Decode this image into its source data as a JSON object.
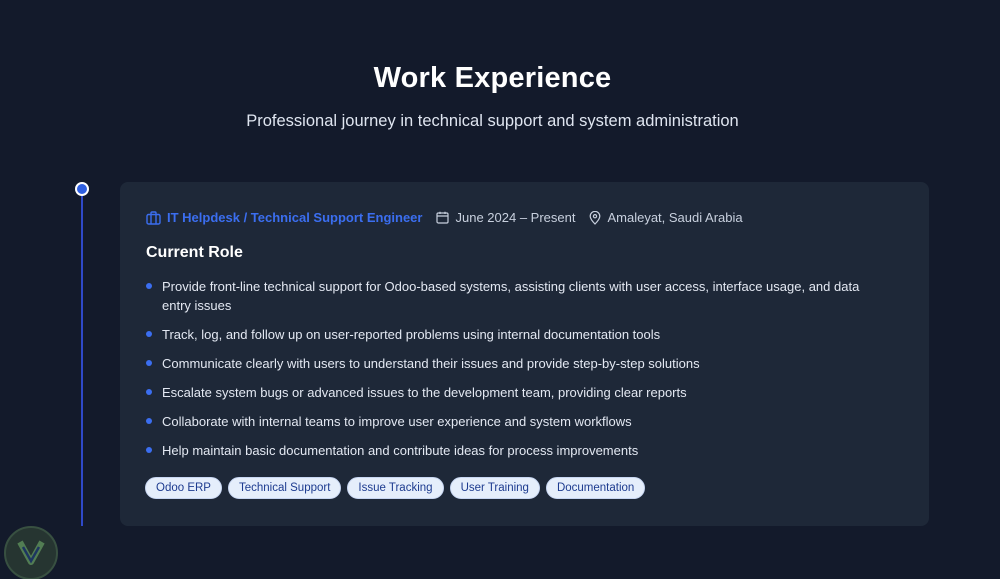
{
  "section": {
    "title": "Work Experience",
    "subtitle": "Professional journey in technical support and system administration"
  },
  "job": {
    "title": "IT Helpdesk / Technical Support Engineer",
    "dates": "June 2024 – Present",
    "location": "Amaleyat, Saudi Arabia",
    "role_heading": "Current Role",
    "duties": [
      "Provide front-line technical support for Odoo-based systems, assisting clients with user access, interface usage, and data entry issues",
      "Track, log, and follow up on user-reported problems using internal documentation tools",
      "Communicate clearly with users to understand their issues and provide step-by-step solutions",
      "Escalate system bugs or advanced issues to the development team, providing clear reports",
      "Collaborate with internal teams to improve user experience and system workflows",
      "Help maintain basic documentation and contribute ideas for process improvements"
    ],
    "tags": [
      "Odoo ERP",
      "Technical Support",
      "Issue Tracking",
      "User Training",
      "Documentation"
    ]
  },
  "icons": {
    "job": "briefcase-icon",
    "dates": "calendar-icon",
    "location": "map-pin-icon"
  },
  "colors": {
    "background": "#131a2b",
    "card": "#1e2838",
    "accent": "#3b6ef0",
    "tag_bg": "#e5eefb",
    "tag_text": "#1d3b8f"
  }
}
